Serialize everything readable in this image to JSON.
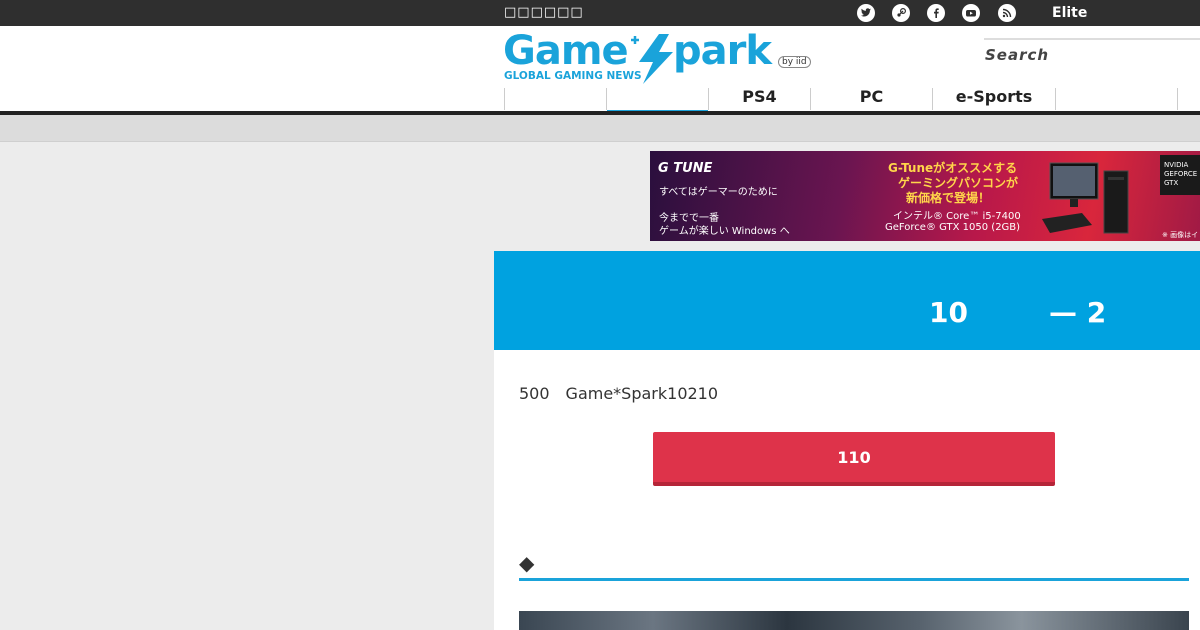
{
  "topbar": {
    "site_text": "□□□□□□",
    "social_icons": [
      "twitter-icon",
      "steam-icon",
      "facebook-icon",
      "youtube-icon",
      "rss-icon"
    ],
    "lock_glyph": "",
    "elite_label": "Elite",
    "elite_chevron": ""
  },
  "header": {
    "logo": {
      "word_left": "Game",
      "word_right": "park",
      "tagline": "GLOBAL GAMING NEWS",
      "by": "by iid"
    },
    "search_label": "Search",
    "nav": [
      {
        "label": ""
      },
      {
        "label": ""
      },
      {
        "label": "PS4"
      },
      {
        "label": "PC"
      },
      {
        "label": "e-Sports"
      },
      {
        "label": ""
      }
    ]
  },
  "banner": {
    "brand": "G TUNE",
    "line1": "すべてはゲーマーのために",
    "line2": "今までで一番",
    "line3": "ゲームが楽しい Windows へ",
    "headline1": "G-Tuneがオススメする",
    "headline2": "ゲーミングパソコンが",
    "headline3": "新価格で登場！",
    "spec1": "インテル® Core™ i5-7400",
    "spec2": "GeForce® GTX 1050 (2GB)",
    "gtx_badge": "NVIDIA GEFORCE GTX",
    "note": "※ 画像はイ"
  },
  "hero": {
    "number1": "10",
    "number2": "— 2"
  },
  "article": {
    "description": "500　Game*Spark10210",
    "cta_label": "110",
    "section_heading": "◆"
  },
  "colors": {
    "accent_blue": "#00a2e0",
    "cta_red": "#de334a",
    "topbar": "#2f2f2f"
  }
}
